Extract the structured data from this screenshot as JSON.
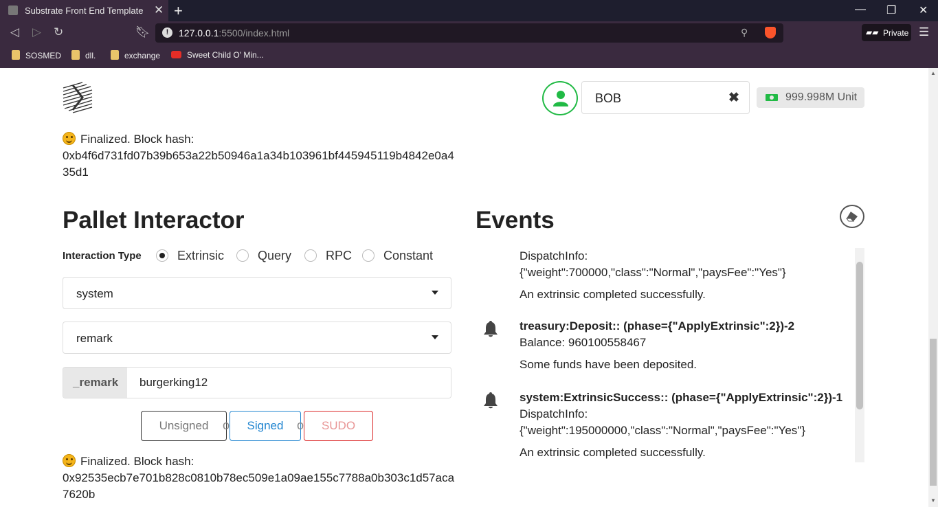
{
  "browser": {
    "tab_title": "Substrate Front End Template",
    "url_host": "127.0.0.1",
    "url_rest": ":5500/index.html",
    "private_label": "Private",
    "bookmarks": [
      "SOSMED",
      "dll.",
      "exchange",
      "Sweet Child O' Min..."
    ]
  },
  "header": {
    "account_value": "BOB",
    "balance": "999.998M Unit"
  },
  "status_top": {
    "prefix": "Finalized. Block hash:",
    "hash": "0xb4f6d731fd07b39b653a22b50946a1a34b103961bf445945119b4842e0a435d1"
  },
  "pallet": {
    "heading": "Pallet Interactor",
    "interaction_type_label": "Interaction Type",
    "radio_options": [
      "Extrinsic",
      "Query",
      "RPC",
      "Constant"
    ],
    "selected_radio": "Extrinsic",
    "pallet_value": "system",
    "callable_value": "remark",
    "param_label": "_remark",
    "param_value": "burgerking12",
    "buttons": {
      "unsigned": "Unsigned",
      "signed": "Signed",
      "sudo": "SUDO",
      "or": "or"
    }
  },
  "status_bottom": {
    "prefix": "Finalized. Block hash:",
    "hash": "0x92535ecb7e701b828c0810b78ec509e1a09ae155c7788a0b303c1d57aca7620b"
  },
  "events": {
    "heading": "Events",
    "items": [
      {
        "title": "",
        "detail_label": "DispatchInfo:",
        "detail_value": "{\"weight\":700000,\"class\":\"Normal\",\"paysFee\":\"Yes\"}",
        "description": "An extrinsic completed successfully."
      },
      {
        "title": "treasury:Deposit:: (phase={\"ApplyExtrinsic\":2})-2",
        "detail_label": "Balance: 960100558467",
        "detail_value": "",
        "description": "Some funds have been deposited."
      },
      {
        "title": "system:ExtrinsicSuccess:: (phase={\"ApplyExtrinsic\":2})-1",
        "detail_label": "DispatchInfo:",
        "detail_value": "{\"weight\":195000000,\"class\":\"Normal\",\"paysFee\":\"Yes\"}",
        "description": "An extrinsic completed successfully."
      }
    ]
  },
  "colors": {
    "signed": "#2185d0",
    "sudo": "#db2828",
    "account_green": "#21ba45"
  }
}
